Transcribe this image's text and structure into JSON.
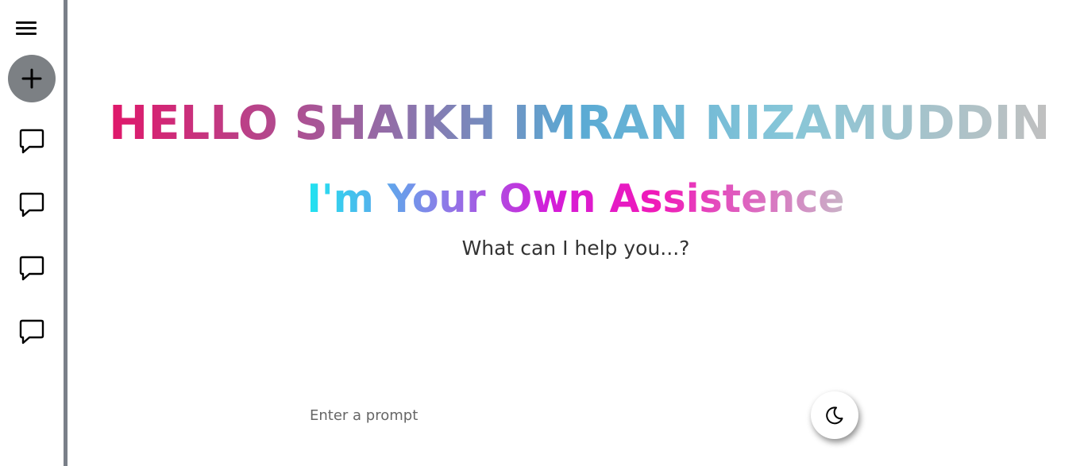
{
  "sidebar": {
    "menu_icon": "hamburger-menu-icon",
    "new_chat_icon": "plus-icon",
    "chat_icon": "speech-bubble-icon",
    "chat_items_count_visible": 4,
    "border_color": "#7a7f89",
    "new_chat_bg": "#7c8084"
  },
  "main": {
    "greeting": "HELLO SHAIKH IMRAN NIZAMUDDIN,",
    "subtitle": "I'm Your Own Assistence",
    "question": "What can I help you...?",
    "prompt": {
      "value": "",
      "placeholder": "Enter a prompt"
    },
    "theme_toggle_icon": "moon-icon"
  },
  "colors": {
    "greeting_gradient": [
      "#e0176a",
      "#a85596",
      "#5aaad4",
      "#86c6d8",
      "#c0c0c0"
    ],
    "subtitle_gradient": [
      "#1fe4f0",
      "#8a7ee8",
      "#d31cd9",
      "#f01ab8",
      "#c9b3c7"
    ],
    "question_text": "#333333"
  }
}
